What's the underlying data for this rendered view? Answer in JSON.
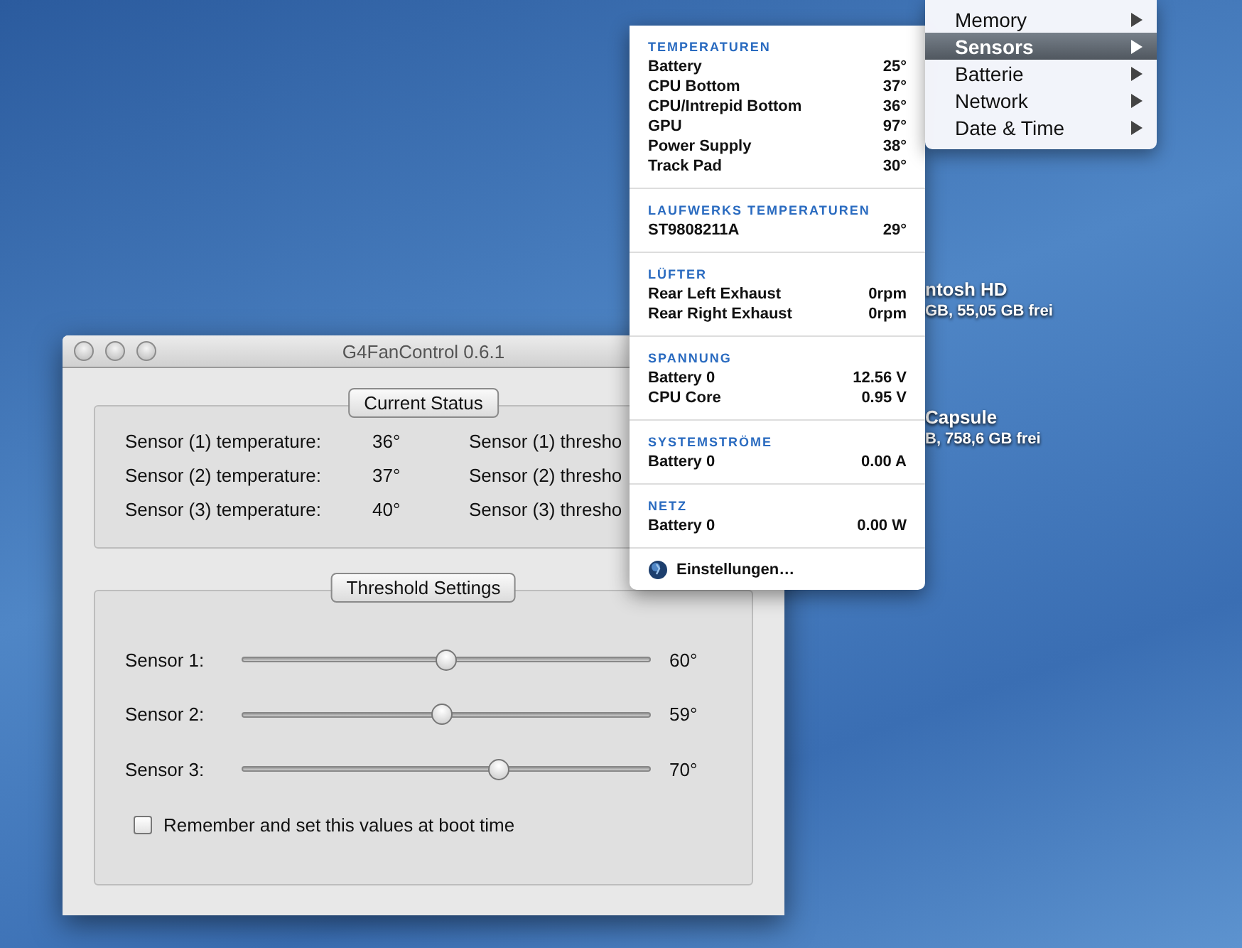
{
  "window": {
    "title": "G4FanControl 0.6.1"
  },
  "current_status": {
    "title": "Current Status",
    "rows": [
      {
        "label": "Sensor (1) temperature:",
        "value": "36°",
        "threshold_label": "Sensor (1) thresho"
      },
      {
        "label": "Sensor (2) temperature:",
        "value": "37°",
        "threshold_label": "Sensor (2) thresho"
      },
      {
        "label": "Sensor (3) temperature:",
        "value": "40°",
        "threshold_label": "Sensor (3) thresho"
      }
    ]
  },
  "threshold_settings": {
    "title": "Threshold Settings",
    "sliders": [
      {
        "label": "Sensor 1:",
        "level": 0.5,
        "reading": "60°"
      },
      {
        "label": "Sensor 2:",
        "level": 0.49,
        "reading": "59°"
      },
      {
        "label": "Sensor 3:",
        "level": 0.63,
        "reading": "70°"
      }
    ],
    "remember": {
      "label": "Remember and set this values at boot time",
      "checked": false
    }
  },
  "sensor_panel": {
    "sections": [
      {
        "heading": "TEMPERATUREN",
        "rows": [
          {
            "name": "Battery",
            "value": "25°"
          },
          {
            "name": "CPU Bottom",
            "value": "37°"
          },
          {
            "name": "CPU/Intrepid Bottom",
            "value": "36°"
          },
          {
            "name": "GPU",
            "value": "97°"
          },
          {
            "name": "Power Supply",
            "value": "38°"
          },
          {
            "name": "Track Pad",
            "value": "30°"
          }
        ]
      },
      {
        "heading": "LAUFWERKS TEMPERATUREN",
        "rows": [
          {
            "name": "ST9808211A",
            "value": "29°"
          }
        ]
      },
      {
        "heading": "LÜFTER",
        "rows": [
          {
            "name": "Rear Left Exhaust",
            "value": "0rpm"
          },
          {
            "name": "Rear Right Exhaust",
            "value": "0rpm"
          }
        ]
      },
      {
        "heading": "SPANNUNG",
        "rows": [
          {
            "name": "Battery 0",
            "value": "12.56 V"
          },
          {
            "name": "CPU Core",
            "value": "0.95 V"
          }
        ]
      },
      {
        "heading": "SYSTEMSTRÖME",
        "rows": [
          {
            "name": "Battery 0",
            "value": "0.00 A"
          }
        ]
      },
      {
        "heading": "NETZ",
        "rows": [
          {
            "name": "Battery 0",
            "value": "0.00 W"
          }
        ]
      }
    ],
    "settings_link": "Einstellungen…"
  },
  "menu": {
    "items": [
      {
        "label": "Memory",
        "selected": false
      },
      {
        "label": "Sensors",
        "selected": true
      },
      {
        "label": "Batterie",
        "selected": false
      },
      {
        "label": "Network",
        "selected": false
      },
      {
        "label": "Date & Time",
        "selected": false
      }
    ]
  },
  "desktop_icons": [
    {
      "name": "ntosh HD",
      "info": "GB, 55,05 GB frei"
    },
    {
      "name": "Capsule",
      "info": "B, 758,6 GB frei"
    }
  ]
}
